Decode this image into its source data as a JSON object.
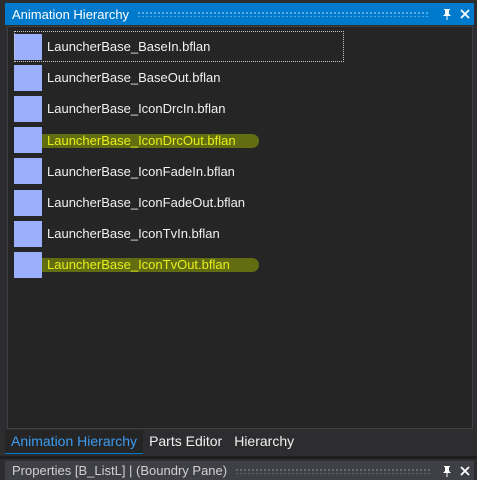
{
  "window": {
    "title": "Animation Hierarchy",
    "pin_icon": "pin-icon",
    "close_icon": "close-icon"
  },
  "list": {
    "items": [
      {
        "label": "LauncherBase_BaseIn.bflan",
        "highlighted": false
      },
      {
        "label": "LauncherBase_BaseOut.bflan",
        "highlighted": false
      },
      {
        "label": "LauncherBase_IconDrcIn.bflan",
        "highlighted": false
      },
      {
        "label": "LauncherBase_IconDrcOut.bflan",
        "highlighted": true
      },
      {
        "label": "LauncherBase_IconFadeIn.bflan",
        "highlighted": false
      },
      {
        "label": "LauncherBase_IconFadeOut.bflan",
        "highlighted": false
      },
      {
        "label": "LauncherBase_IconTvIn.bflan",
        "highlighted": false
      },
      {
        "label": "LauncherBase_IconTvOut.bflan",
        "highlighted": true
      }
    ],
    "swatch_color": "#9ab0ff",
    "highlight_text_color": "#e8ef1a"
  },
  "tabs": [
    {
      "label": "Animation Hierarchy",
      "active": true
    },
    {
      "label": "Parts Editor",
      "active": false
    },
    {
      "label": "Hierarchy",
      "active": false
    }
  ],
  "properties_panel": {
    "title": "Properties [B_ListL]   |   (Boundry Pane)"
  },
  "colors": {
    "accent": "#007acc",
    "background": "#2d2d30",
    "list_background": "#252526"
  }
}
